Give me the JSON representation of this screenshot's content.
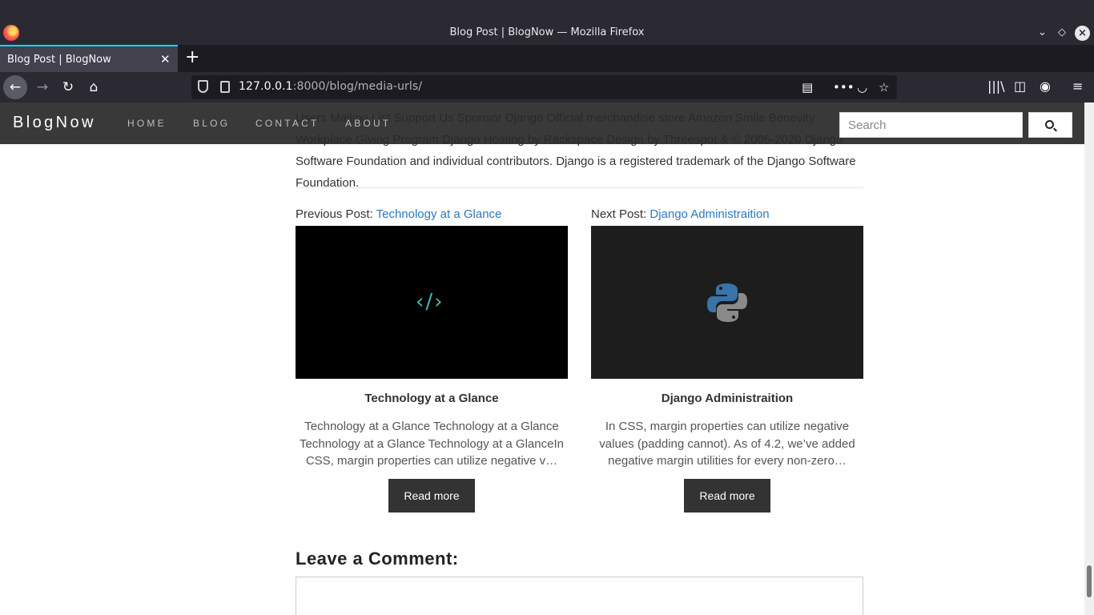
{
  "browser": {
    "window_title": "Blog Post | BlogNow — Mozilla Firefox",
    "tab_title": "Blog Post | BlogNow",
    "url_host": "127.0.0.1",
    "url_rest": ":8000/blog/media-urls/"
  },
  "site": {
    "brand": "BlogNow",
    "nav": [
      "HOME",
      "BLOG",
      "CONTACT",
      "ABOUT"
    ],
    "search_placeholder": "Search"
  },
  "article": {
    "tail_text": "Users Mailing List Support Us Sponsor Django Official merchandise store Amazon Smile Benevity Workplace Giving Program Django Hosting by Rackspace Design by Threespot & © 2005-2020 Django Software Foundation and individual contributors. Django is a registered trademark of the Django Software Foundation."
  },
  "prev_post": {
    "label": "Previous Post: ",
    "link": "Technology at a Glance",
    "title": "Technology at a Glance",
    "excerpt": "Technology at a Glance Technology at a Glance Technology at a Glance Technology at a GlanceIn CSS, margin properties can utilize negative v…",
    "button": "Read more",
    "thumb_icon": "code-icon"
  },
  "next_post": {
    "label": "Next Post: ",
    "link": "Django Administraition",
    "title": "Django Administraition",
    "excerpt": "In CSS, margin properties can utilize negative values (padding cannot). As of 4.2, we’ve added negative margin utilities for every non-zero…",
    "button": "Read more",
    "thumb_icon": "python-logo-icon"
  },
  "comments": {
    "heading": "Leave a Comment:"
  }
}
